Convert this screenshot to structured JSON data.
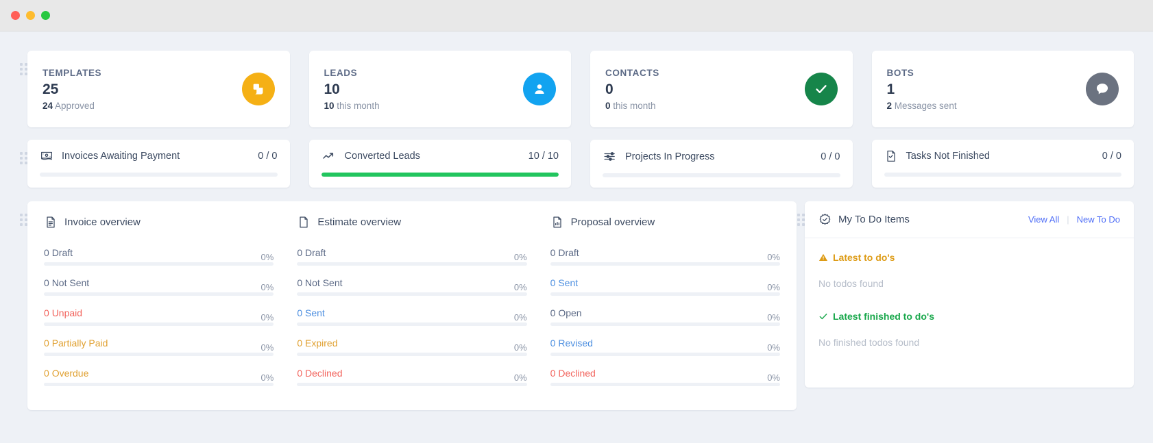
{
  "titlebar": {
    "buttons": [
      "close",
      "minimize",
      "maximize"
    ]
  },
  "stats": [
    {
      "title": "TEMPLATES",
      "value": "25",
      "sub_bold": "24",
      "sub_text": "Approved",
      "icon": "template-icon",
      "color": "#f5b015"
    },
    {
      "title": "LEADS",
      "value": "10",
      "sub_bold": "10",
      "sub_text": "this month",
      "icon": "user-icon",
      "color": "#12a3f0"
    },
    {
      "title": "CONTACTS",
      "value": "0",
      "sub_bold": "0",
      "sub_text": "this month",
      "icon": "check-icon",
      "color": "#16854a"
    },
    {
      "title": "BOTS",
      "value": "1",
      "sub_bold": "2",
      "sub_text": "Messages sent",
      "icon": "chat-icon",
      "color": "#6b7280"
    }
  ],
  "progress": [
    {
      "label": "Invoices Awaiting Payment",
      "count": "0 / 0",
      "percent": 0,
      "icon": "invoice-icon"
    },
    {
      "label": "Converted Leads",
      "count": "10 / 10",
      "percent": 100,
      "icon": "trending-up-icon"
    },
    {
      "label": "Projects In Progress",
      "count": "0 / 0",
      "percent": 0,
      "icon": "sliders-icon"
    },
    {
      "label": "Tasks Not Finished",
      "count": "0 / 0",
      "percent": 0,
      "icon": "task-doc-icon"
    }
  ],
  "overviews": [
    {
      "title": "Invoice overview",
      "icon": "document-lines-icon",
      "items": [
        {
          "count": "0",
          "label": "Draft",
          "percent": "0%",
          "color": "#5c6a86"
        },
        {
          "count": "0",
          "label": "Not Sent",
          "percent": "0%",
          "color": "#5c6a86"
        },
        {
          "count": "0",
          "label": "Unpaid",
          "percent": "0%",
          "color": "#f2635c"
        },
        {
          "count": "0",
          "label": "Partially Paid",
          "percent": "0%",
          "color": "#e0a030"
        },
        {
          "count": "0",
          "label": "Overdue",
          "percent": "0%",
          "color": "#e0a030"
        }
      ]
    },
    {
      "title": "Estimate overview",
      "icon": "document-blank-icon",
      "items": [
        {
          "count": "0",
          "label": "Draft",
          "percent": "0%",
          "color": "#5c6a86"
        },
        {
          "count": "0",
          "label": "Not Sent",
          "percent": "0%",
          "color": "#5c6a86"
        },
        {
          "count": "0",
          "label": "Sent",
          "percent": "0%",
          "color": "#4d8fe0"
        },
        {
          "count": "0",
          "label": "Expired",
          "percent": "0%",
          "color": "#e0a030"
        },
        {
          "count": "0",
          "label": "Declined",
          "percent": "0%",
          "color": "#f2635c"
        }
      ]
    },
    {
      "title": "Proposal overview",
      "icon": "document-chart-icon",
      "items": [
        {
          "count": "0",
          "label": "Draft",
          "percent": "0%",
          "color": "#5c6a86"
        },
        {
          "count": "0",
          "label": "Sent",
          "percent": "0%",
          "color": "#4d8fe0"
        },
        {
          "count": "0",
          "label": "Open",
          "percent": "0%",
          "color": "#5c6a86"
        },
        {
          "count": "0",
          "label": "Revised",
          "percent": "0%",
          "color": "#4d8fe0"
        },
        {
          "count": "0",
          "label": "Declined",
          "percent": "0%",
          "color": "#f2635c"
        }
      ]
    }
  ],
  "todo": {
    "icon": "check-badge-icon",
    "title": "My To Do Items",
    "view_all": "View All",
    "separator": "|",
    "new_todo": "New To Do",
    "latest_title": "Latest to do's",
    "latest_empty": "No todos found",
    "finished_title": "Latest finished to do's",
    "finished_empty": "No finished todos found",
    "warn_color": "#dd9b15",
    "ok_color": "#17a74a",
    "link_color": "#4f6ef7"
  }
}
